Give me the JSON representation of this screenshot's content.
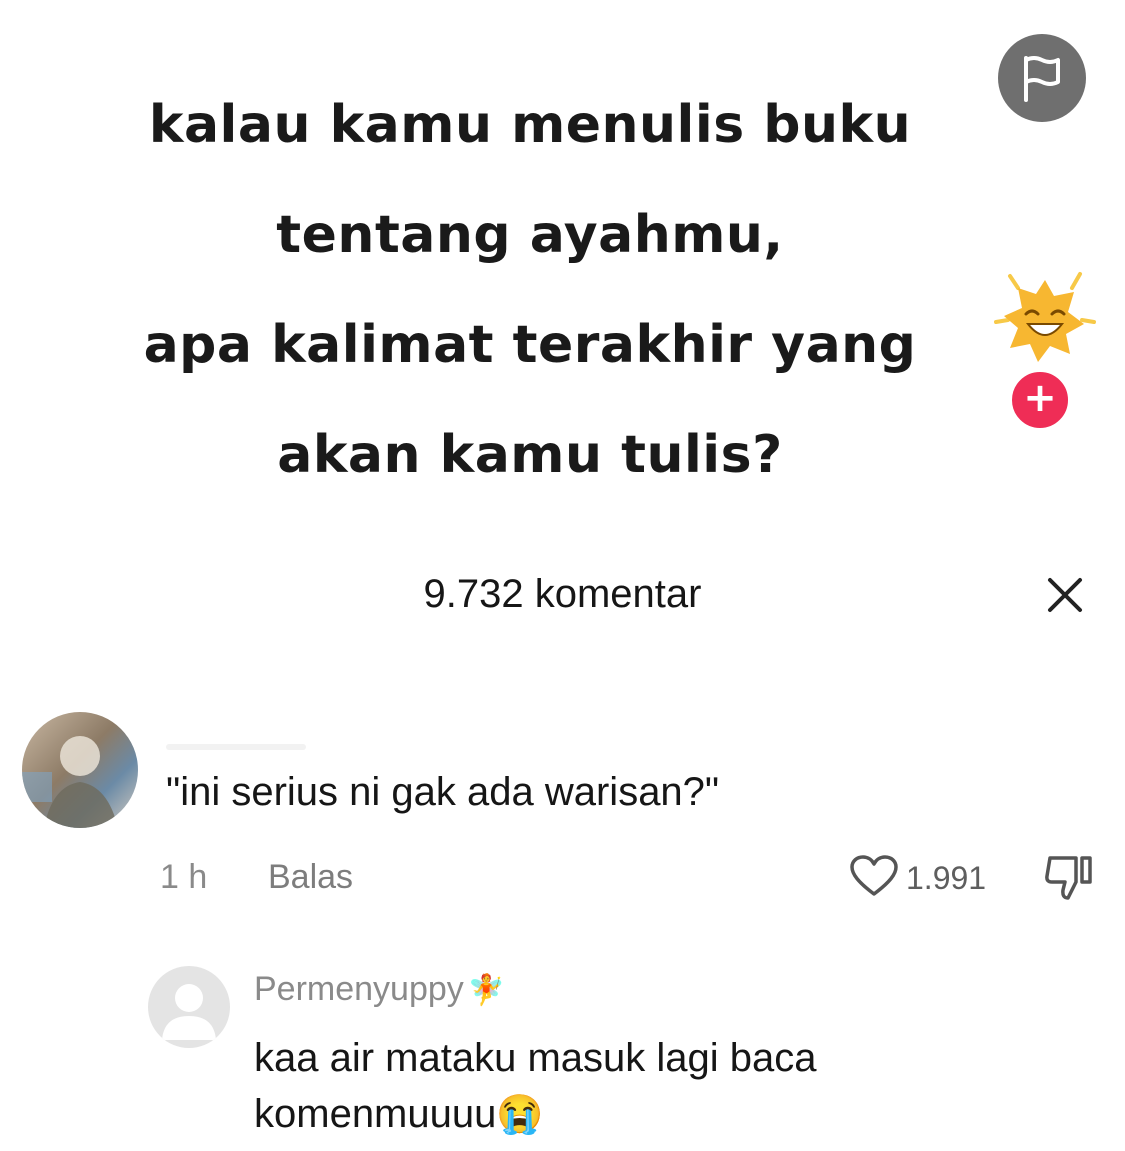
{
  "video": {
    "caption_lines": [
      "kalau kamu menulis buku",
      "tentang ayahmu,",
      "apa kalimat terakhir yang",
      "akan kamu tulis?"
    ],
    "flag_icon": "flag-icon",
    "sticker_icon": "laughing-sun-sticker-icon",
    "follow_icon": "plus-icon",
    "follow_color": "#ef2d56"
  },
  "sheet": {
    "comment_count": "9.732 komentar",
    "close_icon": "close-icon"
  },
  "comment": {
    "text": "\"ini serius ni gak ada warisan?\"",
    "time": "1 h",
    "reply_label": "Balas",
    "like_count": "1.991",
    "like_icon": "heart-icon",
    "dislike_icon": "thumbs-down-icon"
  },
  "reply": {
    "author": "Permenyuppy",
    "author_emoji": "🧚",
    "text_line1": "kaa air mataku masuk lagi baca",
    "text_line2": "komenmuuuu",
    "emoji": "😭"
  },
  "colors": {
    "text_primary": "#161616",
    "text_secondary": "#8a8a8a",
    "flag_bg": "#6f6f6f"
  }
}
